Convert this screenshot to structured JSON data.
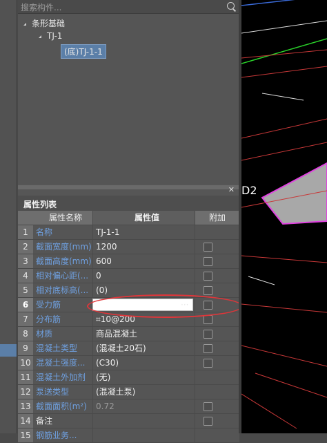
{
  "search": {
    "placeholder": "搜索构件..."
  },
  "tree": {
    "root": "条形基础",
    "child": "TJ-1",
    "leaf": "(底)TJ-1-1"
  },
  "props": {
    "title": "属性列表",
    "headers": {
      "name": "属性名称",
      "value": "属性值",
      "extra": "附加"
    },
    "rows": [
      {
        "no": "1",
        "name": "名称",
        "value": "TJ-1-1",
        "checkbox": false
      },
      {
        "no": "2",
        "name": "截面宽度(mm)",
        "value": "1200",
        "checkbox": true
      },
      {
        "no": "3",
        "name": "截面高度(mm)",
        "value": "600",
        "checkbox": true
      },
      {
        "no": "4",
        "name": "相对偏心距(...",
        "value": "0",
        "checkbox": true
      },
      {
        "no": "5",
        "name": "相对底标高(...",
        "value": "(0)",
        "checkbox": true
      },
      {
        "no": "6",
        "name": "受力筋",
        "value": "",
        "checkbox": true,
        "editing": true
      },
      {
        "no": "7",
        "name": "分布筋",
        "value": "⌗10@200",
        "checkbox": true
      },
      {
        "no": "8",
        "name": "材质",
        "value": "商品混凝土",
        "checkbox": true
      },
      {
        "no": "9",
        "name": "混凝土类型",
        "value": "(混凝土20石)",
        "checkbox": true
      },
      {
        "no": "10",
        "name": "混凝土强度...",
        "value": "(C30)",
        "checkbox": true
      },
      {
        "no": "11",
        "name": "混凝土外加剂",
        "value": "(无)",
        "checkbox": false
      },
      {
        "no": "12",
        "name": "泵送类型",
        "value": "(混凝土泵)",
        "checkbox": false
      },
      {
        "no": "13",
        "name": "截面面积(m²)",
        "value": "0.72",
        "checkbox": true
      },
      {
        "no": "14",
        "name": "备注",
        "value": "",
        "checkbox": true
      },
      {
        "no": "15",
        "name": "钢筋业务...",
        "value": "",
        "checkbox": false
      }
    ]
  },
  "scene": {
    "label": "D2"
  },
  "colors": {
    "selected": "#5b7fa8",
    "highlight": "#e0363a",
    "magenta": "#e040e0"
  }
}
